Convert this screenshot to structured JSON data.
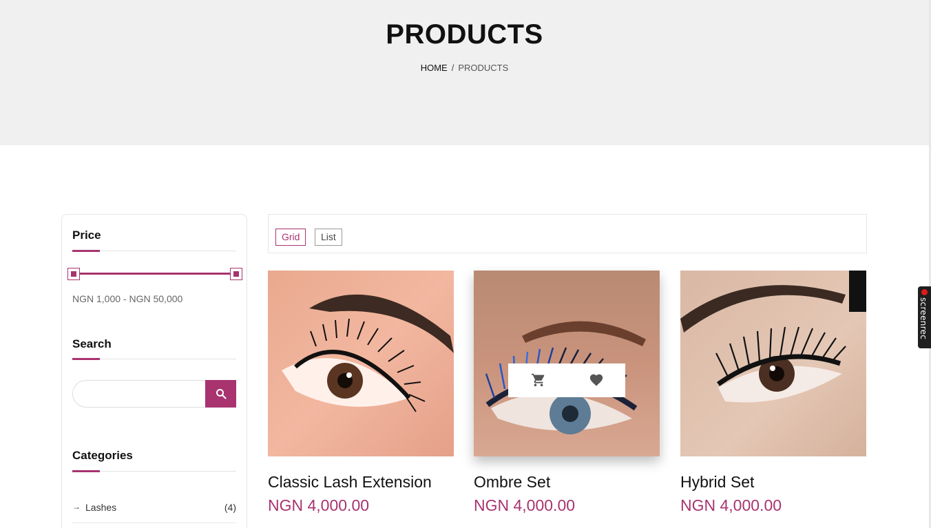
{
  "hero": {
    "title": "PRODUCTS",
    "breadcrumb": {
      "home": "HOME",
      "separator": "/",
      "current": "PRODUCTS"
    }
  },
  "sidebar": {
    "price": {
      "title": "Price",
      "range_text": "NGN 1,000 - NGN 50,000",
      "min_value": 1000,
      "max_value": 50000
    },
    "search": {
      "title": "Search",
      "placeholder": "",
      "button_icon": "search-icon"
    },
    "categories": {
      "title": "Categories",
      "items": [
        {
          "label": "Lashes",
          "count": "(4)"
        }
      ]
    }
  },
  "toolbar": {
    "grid_label": "Grid",
    "list_label": "List",
    "active_view": "grid"
  },
  "products": [
    {
      "name": "Classic Lash Extension",
      "price": "NGN 4,000.00"
    },
    {
      "name": "Ombre Set",
      "price": "NGN 4,000.00",
      "actions": [
        "cart-icon",
        "heart-icon"
      ]
    },
    {
      "name": "Hybrid Set",
      "price": "NGN 4,000.00"
    }
  ],
  "recorder_badge": {
    "label": "screenrec"
  },
  "colors": {
    "accent": "#a8336f",
    "hero_background": "#f0f0f0"
  }
}
